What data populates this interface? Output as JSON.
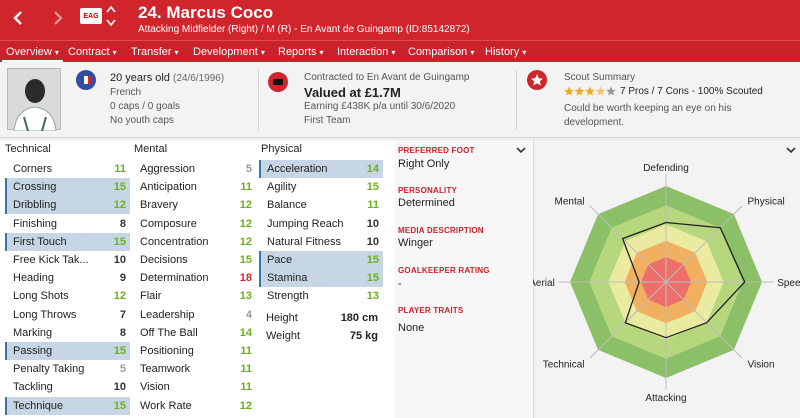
{
  "header": {
    "badge": "EAG",
    "player_name": "24. Marcus Coco",
    "player_sub": "Attacking Midfielder (Right) / M (R) - En Avant de Guingamp (ID:85142872)"
  },
  "menu": [
    {
      "label": "Overview",
      "caret": "▾"
    },
    {
      "label": "Contract",
      "caret": "▾"
    },
    {
      "label": "Transfer",
      "caret": "▾"
    },
    {
      "label": "Development",
      "caret": "▾"
    },
    {
      "label": "Reports",
      "caret": "▾"
    },
    {
      "label": "Interaction",
      "caret": "▾"
    },
    {
      "label": "Comparison",
      "caret": "▾"
    },
    {
      "label": "History",
      "caret": "▾"
    }
  ],
  "info": {
    "age": "20 years old",
    "dob": "(24/6/1996)",
    "nationality": "French",
    "caps": "0 caps / 0 goals",
    "youth_caps": "No youth caps",
    "contract_line": "Contracted to En Avant de Guingamp",
    "value": "Valued at £1.7M",
    "earning": "Earning £438K p/a until 30/6/2020",
    "squad": "First Team",
    "scout_title": "Scout Summary",
    "scout_stars": 3.5,
    "scout_summary": "7 Pros / 7 Cons - 100% Scouted",
    "scout_text_1": "Could be worth keeping an eye on his",
    "scout_text_2": "development."
  },
  "columns": {
    "technical": "Technical",
    "mental": "Mental",
    "physical": "Physical"
  },
  "technical": [
    {
      "label": "Corners",
      "value": "11",
      "color": "green",
      "hl": false
    },
    {
      "label": "Crossing",
      "value": "15",
      "color": "green",
      "hl": true
    },
    {
      "label": "Dribbling",
      "value": "12",
      "color": "green",
      "hl": true
    },
    {
      "label": "Finishing",
      "value": "8",
      "color": "dark",
      "hl": false
    },
    {
      "label": "First Touch",
      "value": "15",
      "color": "green",
      "hl": true
    },
    {
      "label": "Free Kick Tak...",
      "value": "10",
      "color": "dark",
      "hl": false
    },
    {
      "label": "Heading",
      "value": "9",
      "color": "dark",
      "hl": false
    },
    {
      "label": "Long Shots",
      "value": "12",
      "color": "green",
      "hl": false
    },
    {
      "label": "Long Throws",
      "value": "7",
      "color": "dark",
      "hl": false
    },
    {
      "label": "Marking",
      "value": "8",
      "color": "dark",
      "hl": false
    },
    {
      "label": "Passing",
      "value": "15",
      "color": "green",
      "hl": true
    },
    {
      "label": "Penalty Taking",
      "value": "5",
      "color": "grey",
      "hl": false
    },
    {
      "label": "Tackling",
      "value": "10",
      "color": "dark",
      "hl": false
    },
    {
      "label": "Technique",
      "value": "15",
      "color": "green",
      "hl": true
    }
  ],
  "mental": [
    {
      "label": "Aggression",
      "value": "5",
      "color": "grey",
      "hl": false
    },
    {
      "label": "Anticipation",
      "value": "11",
      "color": "green",
      "hl": false
    },
    {
      "label": "Bravery",
      "value": "12",
      "color": "green",
      "hl": false
    },
    {
      "label": "Composure",
      "value": "12",
      "color": "green",
      "hl": false
    },
    {
      "label": "Concentration",
      "value": "12",
      "color": "green",
      "hl": false
    },
    {
      "label": "Decisions",
      "value": "15",
      "color": "green",
      "hl": false
    },
    {
      "label": "Determination",
      "value": "18",
      "color": "red",
      "hl": false
    },
    {
      "label": "Flair",
      "value": "13",
      "color": "green",
      "hl": false
    },
    {
      "label": "Leadership",
      "value": "4",
      "color": "grey",
      "hl": false
    },
    {
      "label": "Off The Ball",
      "value": "14",
      "color": "green",
      "hl": false
    },
    {
      "label": "Positioning",
      "value": "11",
      "color": "green",
      "hl": false
    },
    {
      "label": "Teamwork",
      "value": "11",
      "color": "green",
      "hl": false
    },
    {
      "label": "Vision",
      "value": "11",
      "color": "green",
      "hl": false
    },
    {
      "label": "Work Rate",
      "value": "12",
      "color": "green",
      "hl": false
    }
  ],
  "physical": [
    {
      "label": "Acceleration",
      "value": "14",
      "color": "green",
      "hl": true
    },
    {
      "label": "Agility",
      "value": "15",
      "color": "green",
      "hl": false
    },
    {
      "label": "Balance",
      "value": "11",
      "color": "green",
      "hl": false
    },
    {
      "label": "Jumping Reach",
      "value": "10",
      "color": "dark",
      "hl": false
    },
    {
      "label": "Natural Fitness",
      "value": "10",
      "color": "dark",
      "hl": false
    },
    {
      "label": "Pace",
      "value": "15",
      "color": "green",
      "hl": true
    },
    {
      "label": "Stamina",
      "value": "15",
      "color": "green",
      "hl": true
    },
    {
      "label": "Strength",
      "value": "13",
      "color": "green",
      "hl": false
    }
  ],
  "body": {
    "height_label": "Height",
    "height_value": "180 cm",
    "weight_label": "Weight",
    "weight_value": "75 kg"
  },
  "details": {
    "foot_head": "PREFERRED FOOT",
    "foot_val": "Right Only",
    "personality_head": "PERSONALITY",
    "personality_val": "Determined",
    "media_head": "MEDIA DESCRIPTION",
    "media_val": "Winger",
    "gk_head": "GOALKEEPER RATING",
    "gk_val": "-",
    "traits_head": "PLAYER TRAITS",
    "traits_val": "None"
  },
  "radar": {
    "labels": [
      "Defending",
      "Physical",
      "Speed",
      "Vision",
      "Attacking",
      "Technical",
      "Aerial",
      "Mental"
    ],
    "values": [
      0.62,
      0.8,
      0.82,
      0.6,
      0.58,
      0.6,
      0.28,
      0.64
    ]
  },
  "colors": {
    "accent": "#d0252c",
    "green_value": "#6ab020",
    "red_value": "#d8282e",
    "highlight": "#c6d6e4"
  }
}
